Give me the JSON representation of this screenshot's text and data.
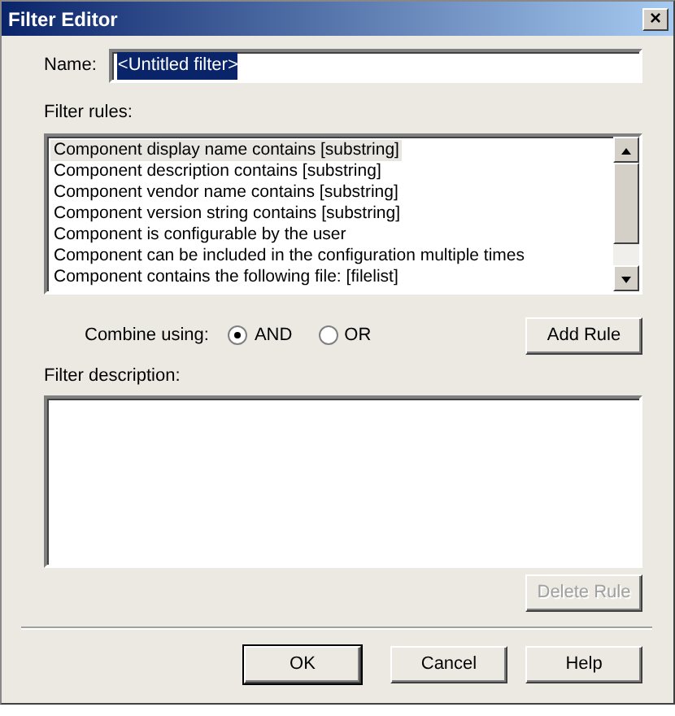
{
  "window": {
    "title": "Filter Editor",
    "close": "×"
  },
  "name_field": {
    "label": "Name:",
    "value": "<Untitled filter>",
    "selected_text": true
  },
  "filter_rules": {
    "label": "Filter rules:",
    "items": [
      {
        "text": "Component display name contains [substring]",
        "selected": true
      },
      {
        "text": "Component description contains [substring]",
        "selected": false
      },
      {
        "text": "Component vendor name contains [substring]",
        "selected": false
      },
      {
        "text": "Component version string contains [substring]",
        "selected": false
      },
      {
        "text": "Component is configurable by the user",
        "selected": false
      },
      {
        "text": "Component can be included in the configuration multiple times",
        "selected": false
      },
      {
        "text": "Component contains the following file: [filelist]",
        "selected": false
      }
    ]
  },
  "combine": {
    "label": "Combine using:",
    "options": [
      {
        "label": "AND",
        "selected": true
      },
      {
        "label": "OR",
        "selected": false
      }
    ]
  },
  "add_rule_button": {
    "label": "Add Rule",
    "disabled": false
  },
  "filter_description": {
    "label": "Filter description:"
  },
  "delete_rule_button": {
    "label": "Delete Rule",
    "disabled": true
  },
  "buttons": [
    {
      "label": "OK",
      "default": true
    },
    {
      "label": "Cancel",
      "default": false
    },
    {
      "label": "Help",
      "default": false
    }
  ]
}
